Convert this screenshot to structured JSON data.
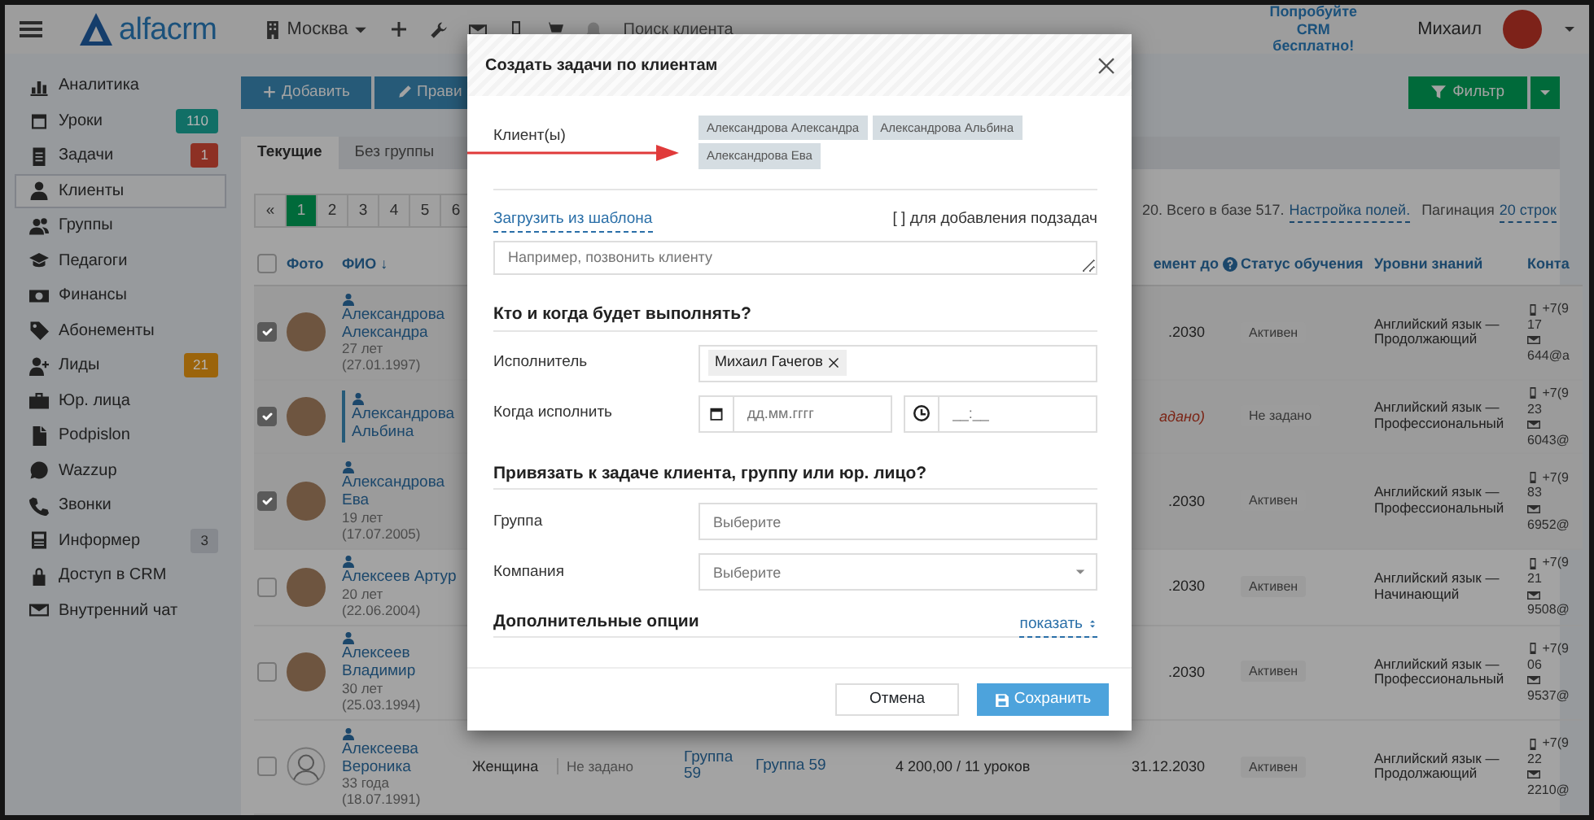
{
  "topbar": {
    "logo": "alfacrm",
    "branch": "Москва",
    "search_placeholder": "Поиск клиента",
    "promo": "Попробуйте CRM бесплатно!",
    "user": "Михаил"
  },
  "sidebar": {
    "items": [
      {
        "label": "Аналитика",
        "selected": false
      },
      {
        "label": "Уроки",
        "selected": false,
        "badge": {
          "text": "110",
          "color": "#116f66"
        }
      },
      {
        "label": "Задачи",
        "selected": false,
        "badge": {
          "text": "1",
          "color": "#8d3024"
        }
      },
      {
        "label": "Клиенты",
        "selected": true
      },
      {
        "label": "Группы",
        "selected": false
      },
      {
        "label": "Педагоги",
        "selected": false
      },
      {
        "label": "Финансы",
        "selected": false
      },
      {
        "label": "Абонементы",
        "selected": false
      },
      {
        "label": "Лиды",
        "selected": false,
        "badge": {
          "text": "21",
          "color": "#9b640b"
        }
      },
      {
        "label": "Юр. лица",
        "selected": false
      },
      {
        "label": "Podpislon",
        "selected": false
      },
      {
        "label": "Wazzup",
        "selected": false
      },
      {
        "label": "Звонки",
        "selected": false
      },
      {
        "label": "Информер",
        "selected": false,
        "badge": {
          "text": "3",
          "color": "#86898e"
        }
      },
      {
        "label": "Доступ в CRM",
        "selected": false
      },
      {
        "label": "Внутренний чат",
        "selected": false
      }
    ]
  },
  "toolbar": {
    "add_button": "Добавить",
    "edit_button": "Прави",
    "filter_button": "Фильтр"
  },
  "tabs": [
    {
      "label": "Текущие",
      "selected": true
    },
    {
      "label": "Без группы",
      "selected": false
    }
  ],
  "pagination": [
    {
      "label": "«",
      "selected": false
    },
    {
      "label": "1",
      "selected": true
    },
    {
      "label": "2",
      "selected": false
    },
    {
      "label": "3",
      "selected": false
    },
    {
      "label": "4",
      "selected": false
    },
    {
      "label": "5",
      "selected": false
    },
    {
      "label": "6",
      "selected": false
    }
  ],
  "summary": {
    "total": "20. Всего в базе 517.",
    "fields_link": "Настройка полей.",
    "pagination_label": "Пагинация",
    "rows_link": "20 строк"
  },
  "table": {
    "select_all_checked": false,
    "columns": {
      "photo": "Фото",
      "name": "ФИО ↓",
      "date": "емент до",
      "status": "Статус обучения",
      "level": "Уровни знаний",
      "contacts": "Конта"
    },
    "rows": [
      {
        "checked": true,
        "marked": false,
        "kind": "photo",
        "name": "Александрова Александра",
        "age": "27 лет",
        "dob": "(27.01.1997)",
        "date": ".2030",
        "date_missing": false,
        "status": "Активен",
        "level": "Английский язык — Продолжающий",
        "phone": "+7(9",
        "phone_tail": "17",
        "email": "644@a"
      },
      {
        "checked": true,
        "marked": true,
        "kind": "photo",
        "name": "Александрова Альбина",
        "date": "адано)",
        "date_missing": true,
        "status": "Не задано",
        "level": "Английский язык — Профессиональный",
        "phone": "+7(9",
        "phone_tail": "23",
        "email": "6043@"
      },
      {
        "checked": true,
        "marked": false,
        "kind": "photo",
        "name": "Александрова Ева",
        "age": "19 лет",
        "dob": "(17.07.2005)",
        "date": ".2030",
        "date_missing": false,
        "status": "Активен",
        "level": "Английский язык — Профессиональный",
        "phone": "+7(9",
        "phone_tail": "83",
        "email": "6952@"
      },
      {
        "checked": false,
        "marked": false,
        "kind": "photo",
        "name": "Алексеев Артур",
        "age": "20 лет",
        "dob": "(22.06.2004)",
        "date": ".2030",
        "date_missing": false,
        "status": "Активен",
        "level": "Английский язык — Начинающий",
        "phone": "+7(9",
        "phone_tail": "21",
        "email": "9508@"
      },
      {
        "checked": false,
        "marked": false,
        "kind": "photo",
        "name": "Алексеев Владимир",
        "age": "30 лет",
        "dob": "(25.03.1994)",
        "date": ".2030",
        "date_missing": false,
        "status": "Активен",
        "level": "Английский язык — Профессиональный",
        "phone": "+7(9",
        "phone_tail": "06",
        "email": "9537@"
      },
      {
        "checked": false,
        "marked": false,
        "kind": "silhouette",
        "name": "Алексеева Вероника",
        "age": "33 года",
        "dob": "(18.07.1991)",
        "gender": "Женщина",
        "status_2": "Не задано",
        "group": "Группа 59",
        "group_2": "Группа 59",
        "balance": "4 200,00 / 11 уроков",
        "date": "31.12.2030",
        "date_missing": false,
        "status": "Активен",
        "level": "Английский язык — Продолжающий",
        "phone": "+7(9",
        "phone_tail": "22",
        "email": "2210@"
      }
    ]
  },
  "modal": {
    "title": "Создать задачи по клиентам",
    "clients_label": "Клиент(ы)",
    "clients": [
      "Александрова Александра",
      "Александрова Альбина",
      "Александрова Ева"
    ],
    "template_link": "Загрузить из шаблона",
    "subtask_hint": "[ ] для добавления подзадач",
    "task_placeholder": "Например, позвонить клиенту",
    "section_who": "Кто и когда будет выполнять?",
    "executor_label": "Исполнитель",
    "executor": "Михаил Гачегов",
    "when_label": "Когда исполнить",
    "date_placeholder": "дд.мм.гггг",
    "time_placeholder": "__:__",
    "section_link": "Привязать к задаче клиента, группу или юр. лицо?",
    "group_label": "Группа",
    "group_placeholder": "Выберите",
    "company_label": "Компания",
    "company_placeholder": "Выберите",
    "options_label": "Дополнительные опции",
    "options_link": "показать",
    "cancel_button": "Отмена",
    "save_button": "Сохранить"
  }
}
